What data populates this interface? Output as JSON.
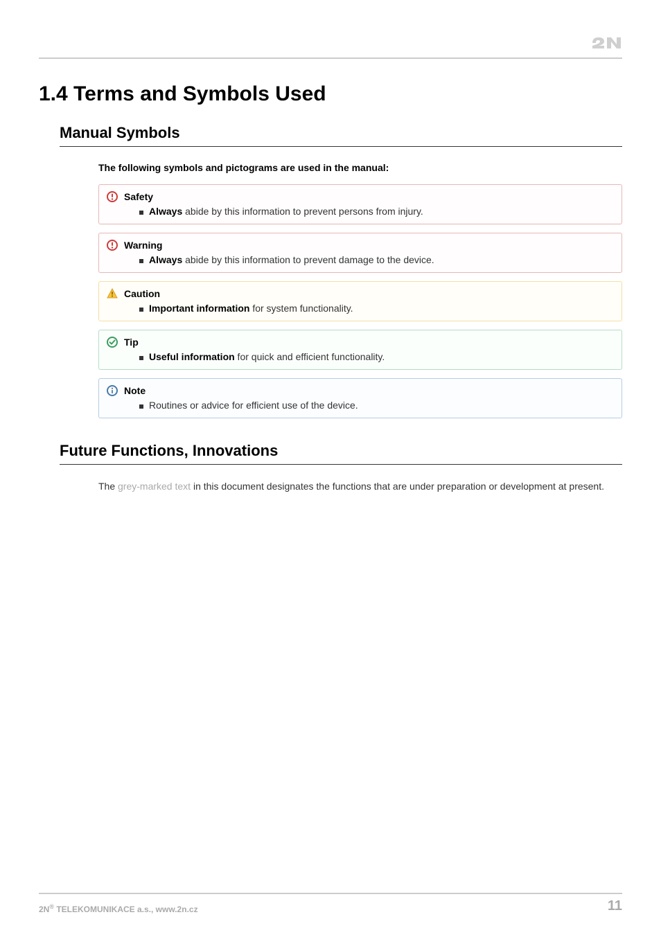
{
  "heading": "1.4 Terms and Symbols Used",
  "section1_title": "Manual Symbols",
  "intro": "The following symbols and pictograms are used in the manual:",
  "callouts": {
    "safety": {
      "title": "Safety",
      "bold": "Always",
      "rest": " abide by this information to prevent persons from injury."
    },
    "warning": {
      "title": "Warning",
      "bold": "Always",
      "rest": " abide by this information to prevent damage to the device."
    },
    "caution": {
      "title": "Caution",
      "bold": "Important information",
      "rest": " for system functionality."
    },
    "tip": {
      "title": "Tip",
      "bold": "Useful information",
      "rest": " for quick and efficient functionality."
    },
    "note": {
      "title": "Note",
      "bold": "",
      "rest": "Routines or advice for efficient use of the device."
    }
  },
  "section2_title": "Future Functions, Innovations",
  "future": {
    "pre": "The ",
    "grey": "grey-marked text",
    "post": " in this document designates the functions that are under preparation or development at present."
  },
  "footer": {
    "company_pre": "2N",
    "company_sup": "®",
    "company_post": " TELEKOMUNIKACE a.s., www.2n.cz",
    "page": "11"
  }
}
